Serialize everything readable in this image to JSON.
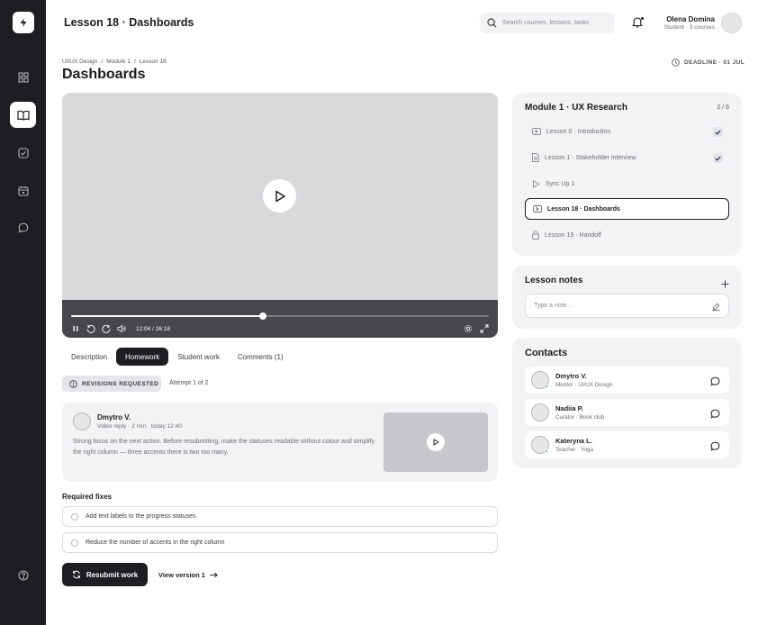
{
  "header": {
    "title": "Lesson 18 · Dashboards",
    "search_placeholder": "Search courses, lessons, tasks",
    "user_name": "Olena Domina",
    "user_role": "Student · 3 courses"
  },
  "breadcrumb": [
    "UI/UX Design",
    "/",
    "Module 1",
    "/",
    "Lesson 18"
  ],
  "page_title": "Dashboards",
  "deadline": "DEADLINE · 01 JUL",
  "video": {
    "time": "12:04 / 26:18",
    "progress": 0.46
  },
  "tabs": [
    "Description",
    "Homework",
    "Student work",
    "Comments (1)"
  ],
  "active_tab": "Homework",
  "homework": {
    "badge": "REVISIONS REQUESTED",
    "attempt": "Attempt 1 of 2",
    "feedback": {
      "name": "Dmytro V.",
      "meta": "Video reply · 2 min · today 12:40",
      "text": "Strong focus on the next action. Before resubmitting, make the statuses readable without colour and simplify the right column — three accents there is two too many."
    },
    "fixes_title": "Required fixes",
    "fixes": [
      "Add text labels to the progress statuses",
      "Reduce the number of accents in the right column"
    ],
    "resubmit_label": "Resubmit work",
    "view_version_label": "View version 1"
  },
  "module": {
    "title": "Module 1 · UX Research",
    "count": "2 / 6",
    "lessons": [
      {
        "label": "Lesson 0 · Introduction",
        "icon": "video-icon",
        "done": true
      },
      {
        "label": "Lesson 1 · Stakeholder interview",
        "icon": "document-icon",
        "done": true
      },
      {
        "label": "Sync Up 1",
        "icon": "play-icon",
        "done": false
      },
      {
        "label": "Lesson 18 · Dashboards",
        "icon": "video-icon",
        "done": false
      },
      {
        "label": "Lesson 19 · Handoff",
        "icon": "lock-icon",
        "done": false
      }
    ]
  },
  "notes": {
    "title": "Lesson notes",
    "placeholder": "Type a note..."
  },
  "contacts": {
    "title": "Contacts",
    "items": [
      {
        "name": "Dmytro V.",
        "role": "Mentor · UI/UX Design"
      },
      {
        "name": "Nadiia P.",
        "role": "Curator · Book club"
      },
      {
        "name": "Kateryna L.",
        "role": "Teacher · Yoga"
      }
    ]
  }
}
